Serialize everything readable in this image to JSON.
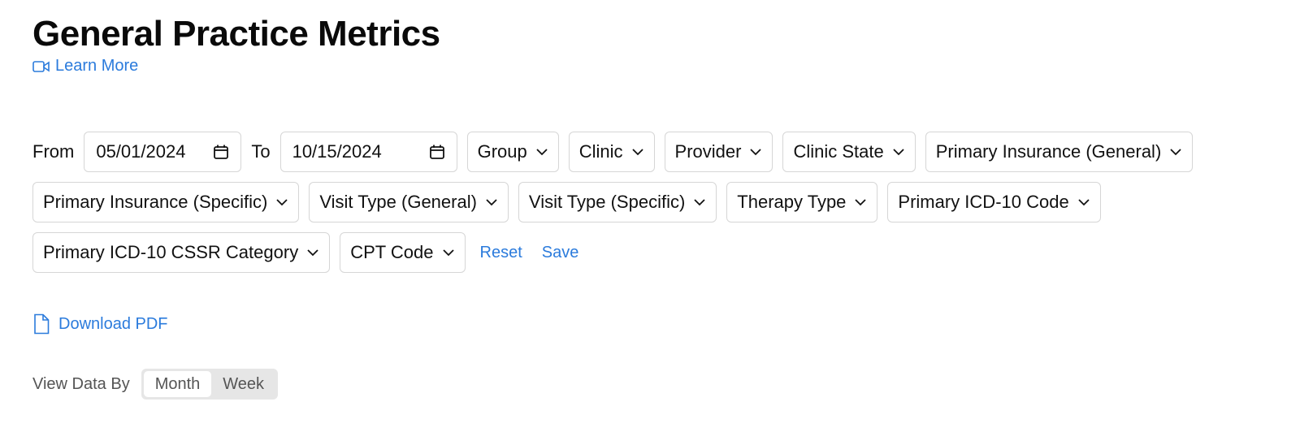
{
  "page": {
    "title": "General Practice Metrics",
    "learn_more": "Learn More"
  },
  "filters": {
    "from_label": "From",
    "from_date": "05/01/2024",
    "to_label": "To",
    "to_date": "10/15/2024",
    "group": "Group",
    "clinic": "Clinic",
    "provider": "Provider",
    "clinic_state": "Clinic State",
    "primary_insurance_general": "Primary Insurance (General)",
    "primary_insurance_specific": "Primary Insurance (Specific)",
    "visit_type_general": "Visit Type (General)",
    "visit_type_specific": "Visit Type (Specific)",
    "therapy_type": "Therapy Type",
    "primary_icd10_code": "Primary ICD-10 Code",
    "primary_icd10_cssr": "Primary ICD-10 CSSR Category",
    "cpt_code": "CPT Code",
    "reset": "Reset",
    "save": "Save"
  },
  "download": {
    "label": "Download PDF"
  },
  "view_by": {
    "label": "View Data By",
    "options": [
      "Month",
      "Week"
    ],
    "selected": "Month"
  },
  "colors": {
    "link": "#2b7bdc",
    "border": "#d6d6d6",
    "segment_bg": "#e6e6e6"
  },
  "icons": {
    "learn_more": "video-camera-icon",
    "date": "calendar-icon",
    "dropdown": "chevron-down-icon",
    "download": "document-icon"
  }
}
